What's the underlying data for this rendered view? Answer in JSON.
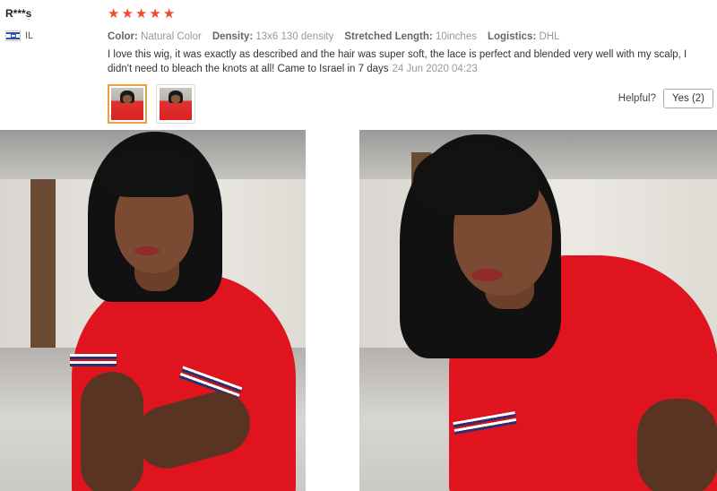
{
  "reviewer": {
    "name": "R***s",
    "country_code": "IL",
    "flag_icon": "israel-flag-icon"
  },
  "review": {
    "rating": 5,
    "stars": [
      "★",
      "★",
      "★",
      "★",
      "★"
    ],
    "star_color": "#f04a2b",
    "attributes": [
      {
        "label": "Color:",
        "value": "Natural Color"
      },
      {
        "label": "Density:",
        "value": "13x6 130 density"
      },
      {
        "label": "Stretched Length:",
        "value": "10inches"
      },
      {
        "label": "Logistics:",
        "value": "DHL"
      }
    ],
    "text": "I love this wig, it was exactly as described and the hair was super soft, the lace is perfect and blended very well with my scalp, I didn't need to bleach the knots at all! Came to Israel in 7 days",
    "date": "24 Jun 2020 04:23"
  },
  "helpful": {
    "label": "Helpful?",
    "yes_button": "Yes (2)"
  },
  "colors": {
    "thumb_active_border": "#e8a045",
    "shirt_red": "#e0141e"
  }
}
